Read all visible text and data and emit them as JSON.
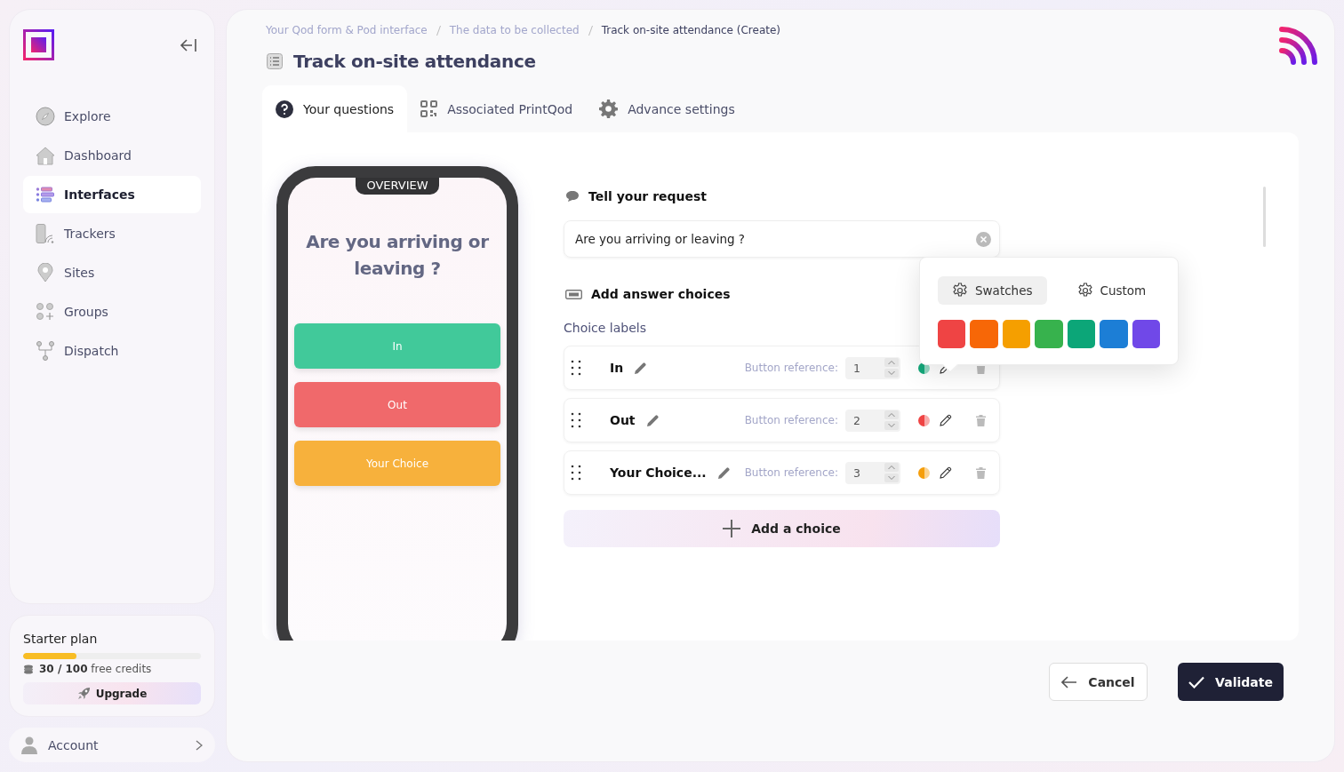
{
  "sidebar": {
    "nav": [
      {
        "label": "Explore",
        "selected": false
      },
      {
        "label": "Dashboard",
        "selected": false
      },
      {
        "label": "Interfaces",
        "selected": true
      },
      {
        "label": "Trackers",
        "selected": false
      },
      {
        "label": "Sites",
        "selected": false
      },
      {
        "label": "Groups",
        "selected": false
      },
      {
        "label": "Dispatch",
        "selected": false
      }
    ],
    "plan": {
      "title": "Starter plan",
      "level": 0.3,
      "credits": "**30 / 100** free credits",
      "upgrade": "Upgrade"
    },
    "account": "Account"
  },
  "breadcrumb": [
    {
      "label": "Your Qod form & Pod interface",
      "current": false
    },
    {
      "label": "The data to be collected",
      "current": false
    },
    {
      "label": "Track on-site attendance (Create)",
      "current": true
    }
  ],
  "title": "Track on-site attendance",
  "tabs": [
    {
      "label": "Your questions",
      "selected": true
    },
    {
      "label": "Associated PrintQod",
      "selected": false
    },
    {
      "label": "Advance settings",
      "selected": false
    }
  ],
  "preview": {
    "badge": "OVERVIEW",
    "question": "Are you arriving or leaving ?",
    "buttons": [
      {
        "label": "In",
        "color": "#41c99a"
      },
      {
        "label": "Out",
        "color": "#f0696b"
      },
      {
        "label": "Your Choice",
        "color": "#f7b13c"
      }
    ]
  },
  "form": {
    "request_heading": "Tell your request",
    "request_value": "Are you arriving or leaving ?",
    "choices_heading": "Add answer choices",
    "choice_labels": "Choice labels",
    "choices": [
      {
        "label": "In",
        "reference_label": "Button reference:",
        "reference": "1",
        "color": "#13a87a"
      },
      {
        "label": "Out",
        "reference_label": "Button reference:",
        "reference": "2",
        "color": "#ef4444"
      },
      {
        "label": "Your Choice...",
        "reference_label": "Button reference:",
        "reference": "3",
        "color": "#f59e0b"
      }
    ],
    "add_button": "Add a choice"
  },
  "color_popup": {
    "tabs": [
      {
        "label": "Swatches",
        "selected": true
      },
      {
        "label": "Custom",
        "selected": false
      }
    ],
    "swatches": [
      {
        "color": "#ef4444"
      },
      {
        "color": "#f76707"
      },
      {
        "color": "#f59f00"
      },
      {
        "color": "#37b24d"
      },
      {
        "color": "#0ca678"
      },
      {
        "color": "#1c7ed6"
      },
      {
        "color": "#7048e8"
      }
    ]
  },
  "actions": {
    "cancel": "Cancel",
    "validate": "Validate"
  }
}
